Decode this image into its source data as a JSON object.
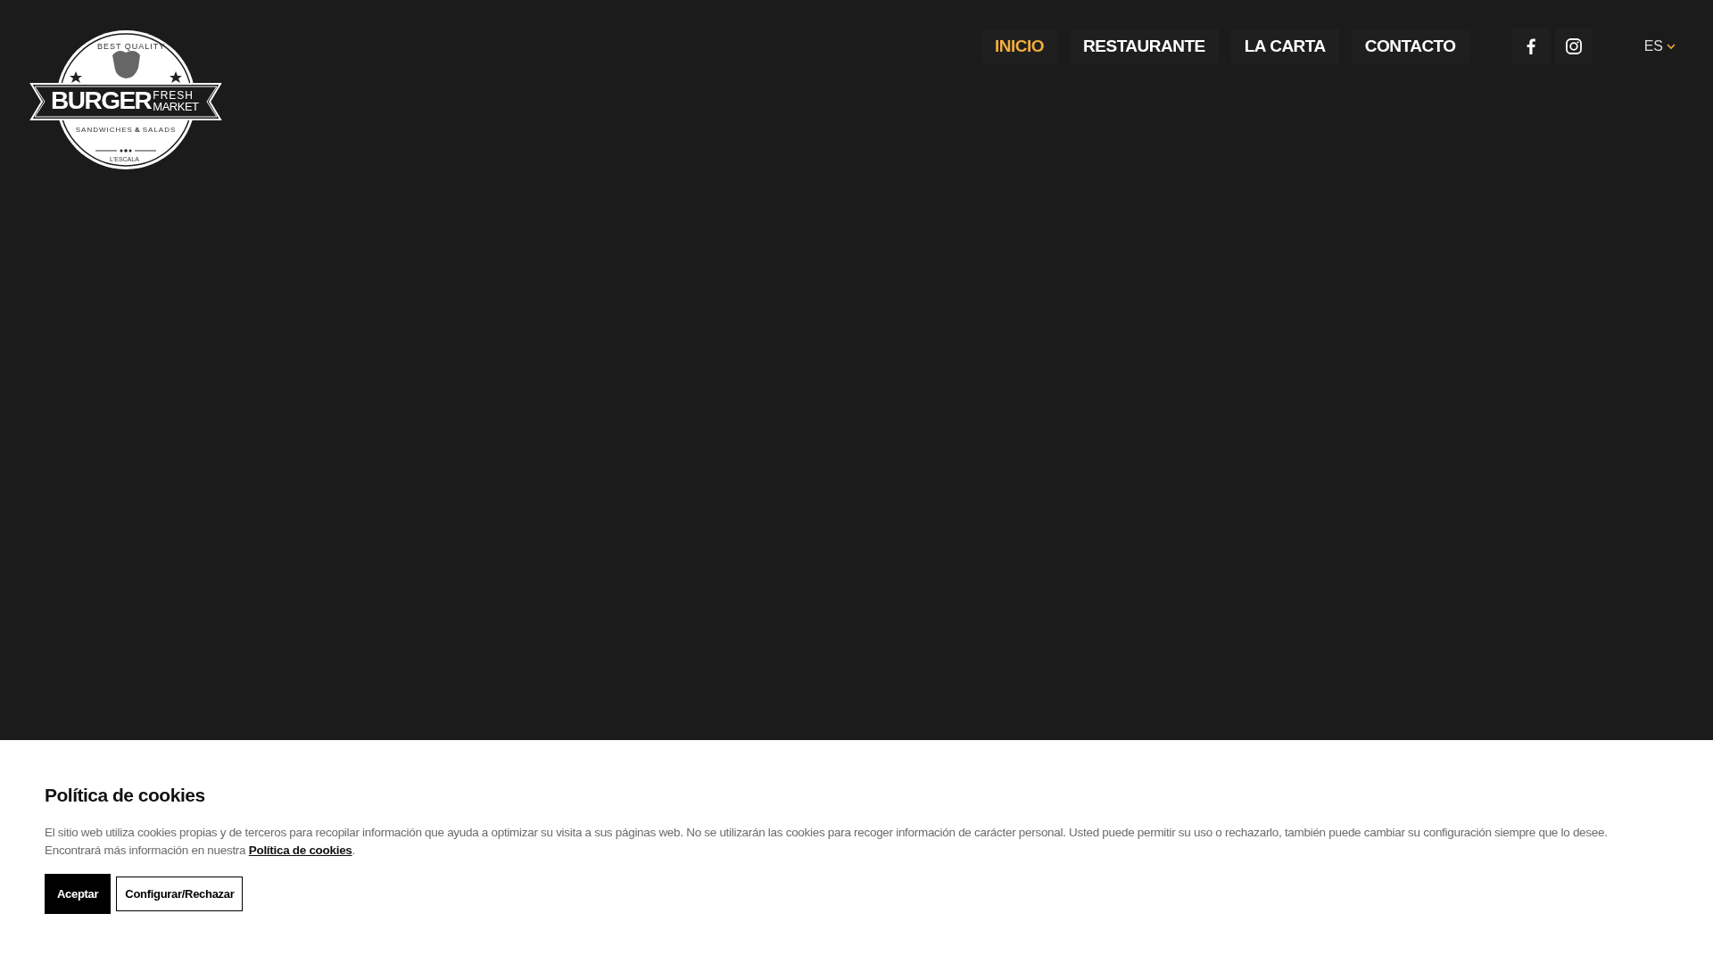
{
  "logo": {
    "top_text": "BEST QUALITY",
    "main_text": "BURGER",
    "side_top": "FRESH",
    "side_bottom": "MARKET",
    "tagline_left": "SANDWICHES",
    "tagline_amp": "&",
    "tagline_right": "SALADS",
    "location": "L'ESCALA"
  },
  "nav": [
    {
      "label": "INICIO",
      "selected": true
    },
    {
      "label": "RESTAURANTE",
      "selected": false
    },
    {
      "label": "LA CARTA",
      "selected": false
    },
    {
      "label": "CONTACTO",
      "selected": false
    }
  ],
  "social": [
    {
      "kind": "facebook"
    },
    {
      "kind": "instagram"
    }
  ],
  "language": "ES",
  "cookie_banner": {
    "title": "Política de cookies",
    "text": "El sitio web utiliza cookies propias y de terceros para recopilar información que ayuda a optimizar su visita a sus páginas web. No se utilizarán las cookies para recoger información de carácter personal. Usted puede permitir su uso o rechazarlo, también puede cambiar su configuración siempre que lo desee.",
    "more_text": "Encontrará más información en nuestra",
    "link": "Política de cookies",
    "link_end": ".",
    "buttons": [
      {
        "label": "Aceptar",
        "kind": "primary"
      },
      {
        "label": "Configurar/Rechazar",
        "kind": "outline"
      }
    ]
  }
}
